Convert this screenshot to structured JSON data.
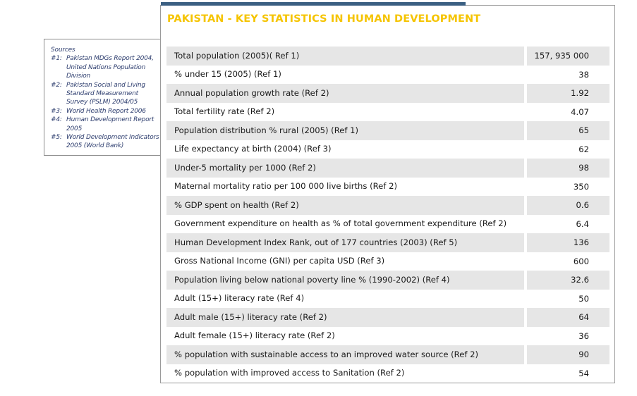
{
  "sources": {
    "title": "Sources",
    "items": [
      {
        "num": "#1:",
        "text": "Pakistan MDGs Report 2004, United Nations Population Division"
      },
      {
        "num": "#2:",
        "text": "Pakistan Social and Living Standard Measurement Survey (PSLM) 2004/05"
      },
      {
        "num": "#3:",
        "text": "World Health Report 2006"
      },
      {
        "num": "#4:",
        "text": "Human Development Report 2005"
      },
      {
        "num": "#5:",
        "text": "World Development Indicators 2005 (World Bank)"
      }
    ]
  },
  "panel": {
    "title": "PAKISTAN - KEY STATISTICS IN HUMAN DEVELOPMENT",
    "title_color": "#f5c400",
    "bar_color": "#3b5f82"
  },
  "rows": [
    {
      "label": "Total population (2005)( Ref 1)",
      "value": "157, 935 000"
    },
    {
      "label": "% under 15 (2005) (Ref 1)",
      "value": "38"
    },
    {
      "label": "Annual population growth rate (Ref 2)",
      "value": "1.92"
    },
    {
      "label": "Total fertility rate (Ref 2)",
      "value": "4.07"
    },
    {
      "label": "Population distribution % rural (2005) (Ref 1)",
      "value": "65"
    },
    {
      "label": "Life expectancy at birth (2004) (Ref 3)",
      "value": "62"
    },
    {
      "label": "Under-5 mortality per 1000 (Ref 2)",
      "value": "98"
    },
    {
      "label": "Maternal mortality ratio per 100 000 live births (Ref 2)",
      "value": "350"
    },
    {
      "label": "% GDP spent on health (Ref 2)",
      "value": "0.6"
    },
    {
      "label": "Government expenditure on health as % of total government expenditure (Ref 2)",
      "value": "6.4"
    },
    {
      "label": "Human Development Index Rank, out of 177 countries (2003) (Ref 5)",
      "value": "136"
    },
    {
      "label": "Gross National Income (GNI) per capita USD (Ref 3)",
      "value": "600"
    },
    {
      "label": "Population living below national poverty line % (1990-2002) (Ref 4)",
      "value": "32.6"
    },
    {
      "label": "Adult (15+) literacy rate (Ref 4)",
      "value": "50"
    },
    {
      "label": "Adult male (15+) literacy rate (Ref 2)",
      "value": "64"
    },
    {
      "label": "Adult female (15+) literacy rate (Ref 2)",
      "value": "36"
    },
    {
      "label": "% population with sustainable access to an improved water source (Ref 2)",
      "value": "90"
    },
    {
      "label": "% population with improved access to Sanitation (Ref 2)",
      "value": "54"
    }
  ]
}
